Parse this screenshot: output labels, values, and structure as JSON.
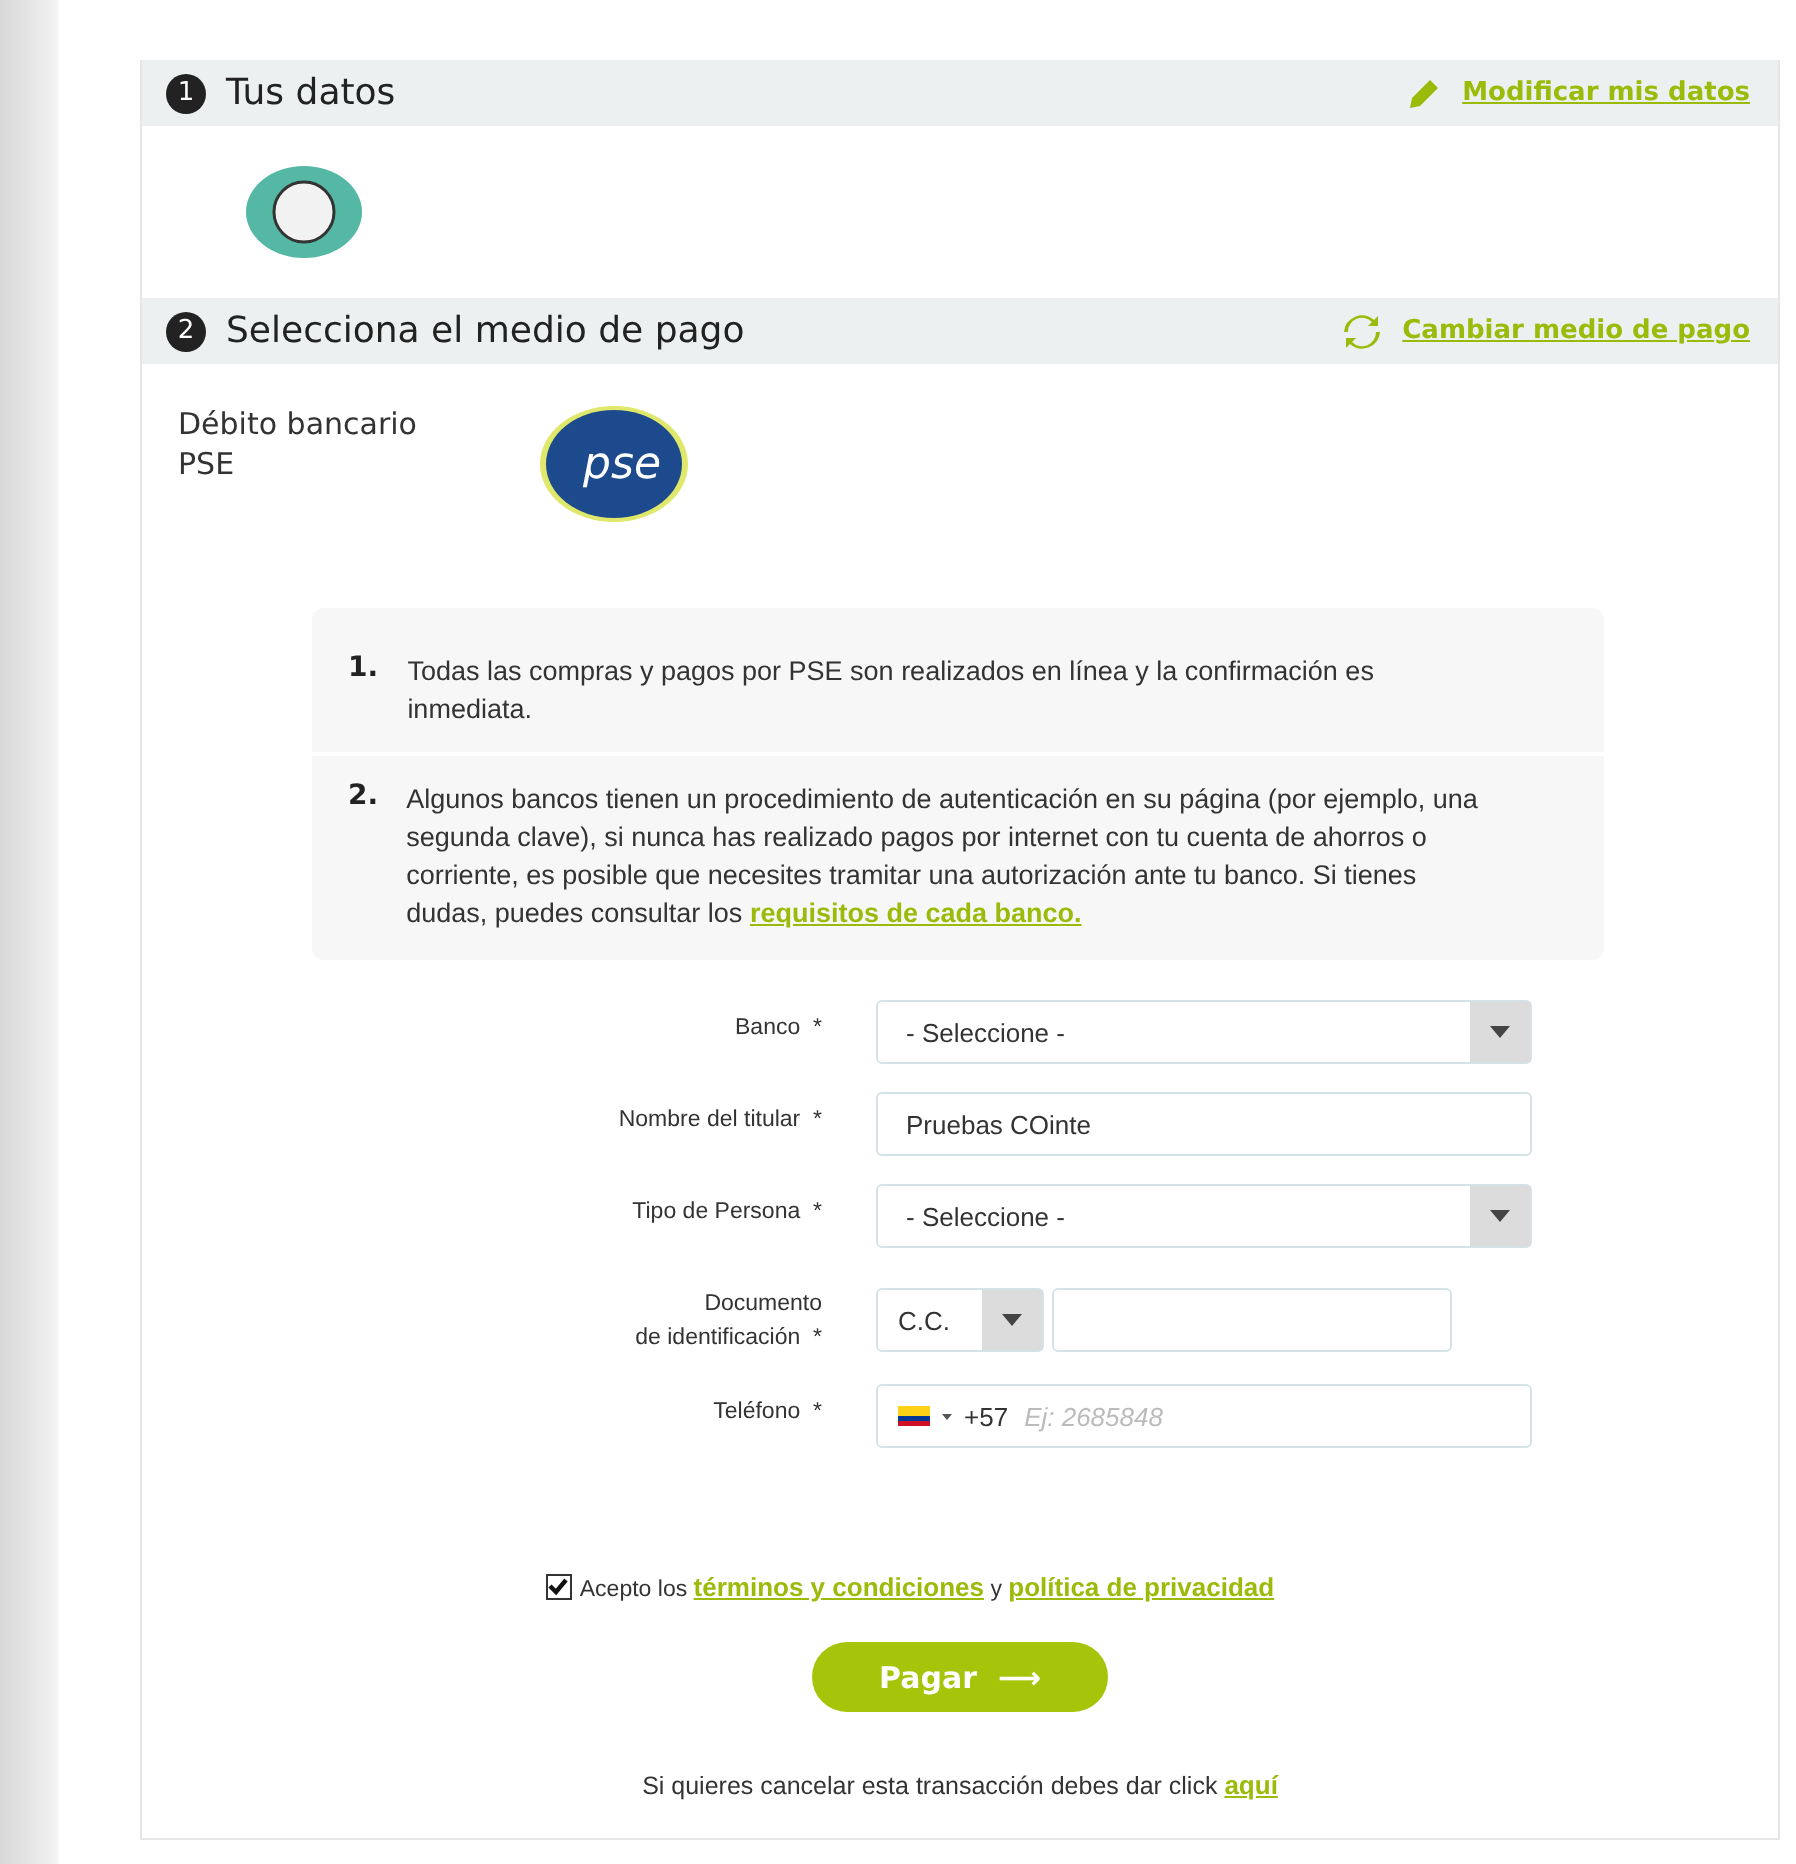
{
  "steps": [
    {
      "number": "1",
      "title": "Tus datos",
      "action": {
        "kind": "edit",
        "label": "Modificar mis datos"
      }
    },
    {
      "number": "2",
      "title": "Selecciona el medio de pago",
      "action": {
        "kind": "change",
        "label": "Cambiar medio de pago"
      }
    }
  ],
  "payment_method": {
    "name_line_1": "Débito bancario",
    "name_line_2": "PSE",
    "logo_text": "pse"
  },
  "notes": [
    {
      "number": "1.",
      "text": "Todas las compras y pagos por PSE son realizados en línea y la confirmación es inmediata."
    },
    {
      "number": "2.",
      "text": "Algunos bancos tienen un procedimiento de autenticación en su página (por ejemplo, una segunda clave), si nunca has realizado pagos por internet con tu cuenta de ahorros o corriente, es posible que necesites tramitar una autorización ante tu banco. Si tienes dudas, puedes consultar los",
      "link": "requisitos de cada banco."
    }
  ],
  "form": [
    {
      "kind": "select",
      "label": "Banco",
      "required": "*",
      "value": "- Seleccione -"
    },
    {
      "kind": "text",
      "label": "Nombre del titular",
      "required": "*",
      "value": "Pruebas COinte"
    },
    {
      "kind": "select",
      "label": "Tipo de Persona",
      "required": "*",
      "value": "- Seleccione -"
    },
    {
      "kind": "document",
      "label": "Documento",
      "label_line_2": "de identificación",
      "required": "*",
      "value": "C.C."
    },
    {
      "kind": "phone",
      "label": "Teléfono",
      "required": "*",
      "prefix": "+57",
      "placeholder": "Ej: 2685848"
    }
  ],
  "terms": {
    "checked": true,
    "prefix": "Acepto los",
    "link_1": "términos y condiciones",
    "middle": "y",
    "link_2": "política de privacidad"
  },
  "pay_button": {
    "label": "Pagar",
    "arrow": "⟶"
  },
  "cancel": {
    "text": "Si quieres cancelar esta transacción debes dar click",
    "link": "aquí"
  }
}
